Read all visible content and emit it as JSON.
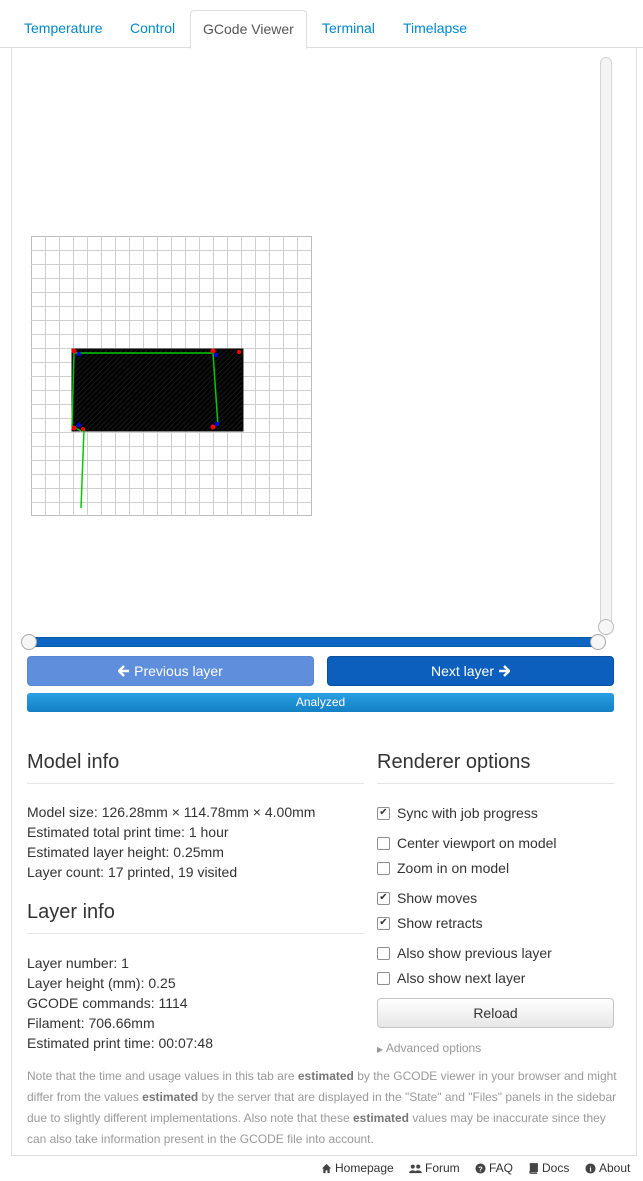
{
  "tabs": [
    {
      "label": "Temperature",
      "active": false
    },
    {
      "label": "Control",
      "active": false
    },
    {
      "label": "GCode Viewer",
      "active": true
    },
    {
      "label": "Terminal",
      "active": false
    },
    {
      "label": "Timelapse",
      "active": false
    }
  ],
  "viewer": {
    "layer_slider": {
      "min_value": 1,
      "max_value": 19,
      "current_value": 1
    },
    "vertical_slider_level": 0
  },
  "buttons": {
    "previous_layer": "Previous layer",
    "next_layer": "Next layer"
  },
  "progress": {
    "label": "Analyzed",
    "percent": 100
  },
  "model_info": {
    "title": "Model info",
    "lines": [
      "Model size: 126.28mm × 114.78mm × 4.00mm",
      "Estimated total print time: 1 hour",
      "Estimated layer height: 0.25mm",
      "Layer count: 17 printed, 19 visited"
    ]
  },
  "layer_info": {
    "title": "Layer info",
    "lines": [
      "Layer number: 1",
      "Layer height (mm): 0.25",
      "GCODE commands: 1114",
      "Filament: 706.66mm",
      "Estimated print time: 00:07:48"
    ]
  },
  "renderer": {
    "title": "Renderer options",
    "options": [
      {
        "label": "Sync with job progress",
        "checked": true
      },
      {
        "label": "Center viewport on model",
        "checked": false
      },
      {
        "label": "Zoom in on model",
        "checked": false
      },
      {
        "label": "Show moves",
        "checked": true
      },
      {
        "label": "Show retracts",
        "checked": true
      },
      {
        "label": "Also show previous layer",
        "checked": false
      },
      {
        "label": "Also show next layer",
        "checked": false
      }
    ],
    "reload_label": "Reload",
    "advanced_label": "Advanced options"
  },
  "note": {
    "parts": [
      "Note that the time and usage values in this tab are ",
      "estimated",
      " by the GCODE viewer in your browser and might differ from the values ",
      "estimated",
      " by the server that are displayed in the \"State\" and \"Files\" panels in the sidebar due to slightly different implementations. Also note that these ",
      "estimated",
      " values may be inaccurate since they can also take information present in the GCODE file into account."
    ]
  },
  "footer": {
    "links": [
      {
        "label": "Homepage",
        "icon": "home-icon"
      },
      {
        "label": "Forum",
        "icon": "users-icon"
      },
      {
        "label": "FAQ",
        "icon": "question-circle-icon"
      },
      {
        "label": "Docs",
        "icon": "book-icon"
      },
      {
        "label": "About",
        "icon": "info-circle-icon"
      }
    ]
  },
  "colors": {
    "link": "#0088cc",
    "primary": "#0c5fbd",
    "primary_light": "#5f8fdc",
    "progress": "#1a8fd6",
    "print_fill": "#000000",
    "move": "#00cc00",
    "retract": "#ff0000",
    "restart": "#0000ff"
  }
}
